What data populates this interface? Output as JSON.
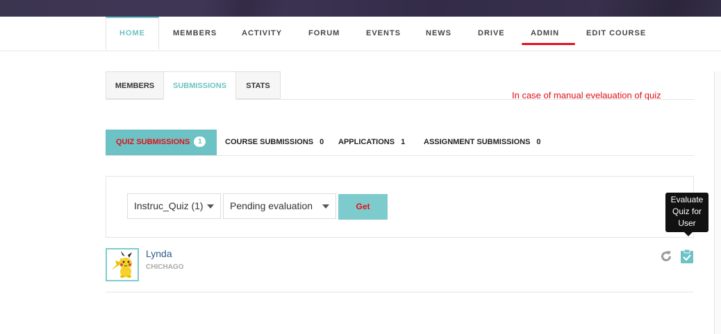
{
  "nav": {
    "items": [
      {
        "label": "HOME",
        "active": true
      },
      {
        "label": "MEMBERS"
      },
      {
        "label": "ACTIVITY"
      },
      {
        "label": "FORUM"
      },
      {
        "label": "EVENTS"
      },
      {
        "label": "NEWS"
      },
      {
        "label": "DRIVE"
      },
      {
        "label": "ADMIN",
        "highlighted": true
      },
      {
        "label": "EDIT COURSE"
      }
    ]
  },
  "subtabs": [
    {
      "label": "MEMBERS"
    },
    {
      "label": "SUBMISSIONS",
      "active": true
    },
    {
      "label": "STATS"
    }
  ],
  "annotation": "In case of manual evelauation of quiz",
  "submission_tabs": [
    {
      "label": "QUIZ SUBMISSIONS",
      "count": "1",
      "active": true
    },
    {
      "label": "COURSE SUBMISSIONS",
      "count": "0"
    },
    {
      "label": "APPLICATIONS",
      "count": "1"
    },
    {
      "label": "ASSIGNMENT SUBMISSIONS",
      "count": "0"
    }
  ],
  "filters": {
    "quiz_select": "Instruc_Quiz (1)",
    "status_select": "Pending evaluation",
    "get_label": "Get"
  },
  "submission": {
    "name": "Lynda",
    "location": "CHICHAGO",
    "avatar_icon": "pikachu-avatar"
  },
  "tooltip": "Evaluate Quiz for User",
  "colors": {
    "accent": "#6cc2c4",
    "highlight": "#e0101a",
    "topbar": "#3c3550"
  }
}
